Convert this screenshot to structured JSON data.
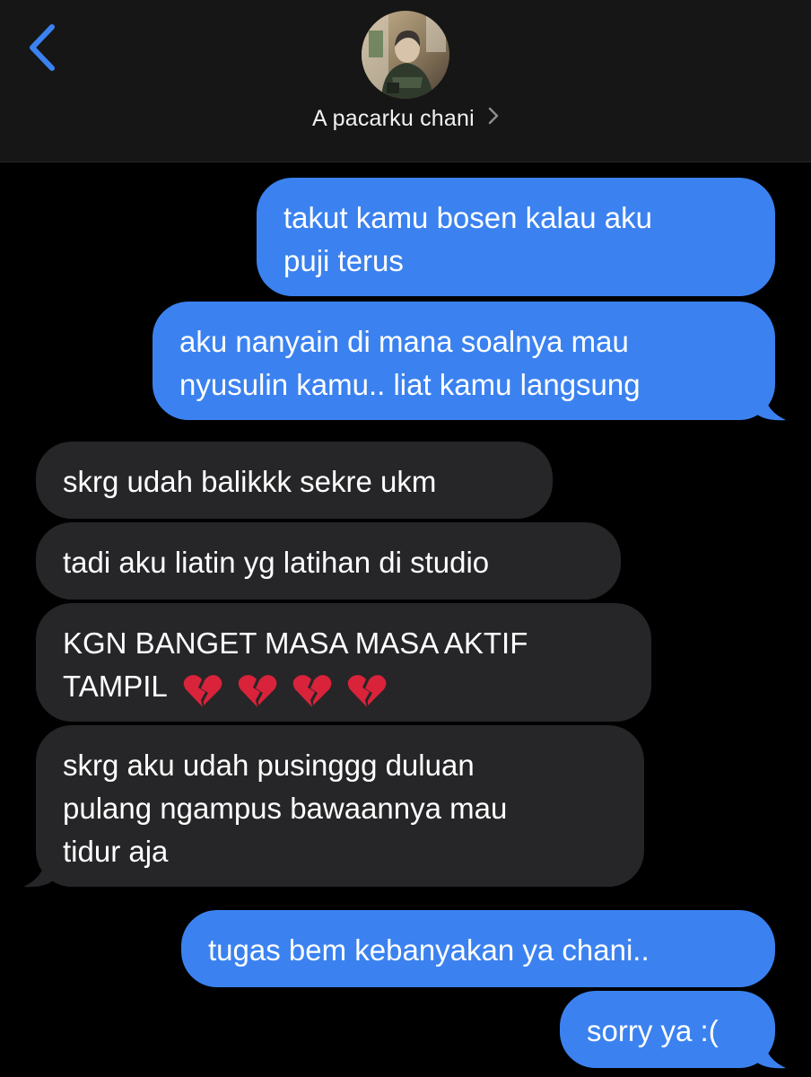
{
  "header": {
    "contact_name": "A pacarku chani",
    "back_icon": "chevron-left-icon",
    "detail_icon": "chevron-right-icon",
    "accent_color": "#3b82f0"
  },
  "messages": [
    {
      "direction": "sent",
      "lines": [
        "takut kamu bosen kalau aku",
        "puji terus"
      ]
    },
    {
      "direction": "sent",
      "lines": [
        "aku nanyain di mana soalnya mau",
        "nyusulin kamu.. liat kamu langsung"
      ]
    },
    {
      "direction": "received",
      "lines": [
        "skrg udah balikkk sekre ukm"
      ]
    },
    {
      "direction": "received",
      "lines": [
        "tadi aku liatin yg latihan di studio"
      ]
    },
    {
      "direction": "received",
      "lines": [
        "KGN BANGET MASA MASA AKTIF",
        "TAMPIL"
      ],
      "emoji": "broken-heart-icon",
      "emoji_count": 4
    },
    {
      "direction": "received",
      "lines": [
        "skrg aku udah pusinggg duluan",
        "pulang ngampus bawaannya mau",
        "tidur aja"
      ]
    },
    {
      "direction": "sent",
      "lines": [
        "tugas bem kebanyakan ya chani.."
      ]
    },
    {
      "direction": "sent",
      "lines": [
        "sorry ya :("
      ]
    }
  ]
}
